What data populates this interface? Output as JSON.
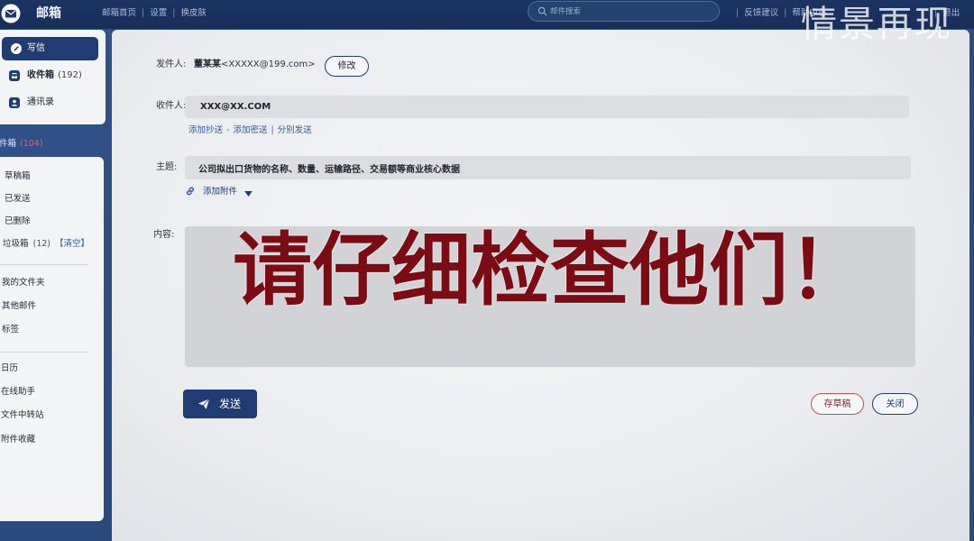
{
  "theme": {
    "header_bg": "#1b3462",
    "primary": "#1f3d73",
    "link": "#2f5a9a",
    "caption": "#7c0c14",
    "danger": "#c0504d",
    "count_alert": "#e0656a"
  },
  "icons": {
    "logo": "envelope-icon",
    "search": "search-icon",
    "compose": "pen-icon",
    "inbox": "inbox-icon",
    "contacts": "contacts-icon",
    "attach": "link-icon",
    "attach_menu": "chevron-down-icon",
    "send": "paper-plane-icon"
  },
  "header": {
    "logo_text": "邮箱",
    "nav": [
      "邮箱首页",
      "设置",
      "换皮肤"
    ],
    "separator": "|",
    "search_placeholder": "邮件搜索",
    "right_links": [
      "反馈建议",
      "帮助中心",
      "退出"
    ],
    "watermark": "情景再现"
  },
  "sidebar": {
    "compose_label": "写信",
    "inbox": {
      "label": "收件箱",
      "count": "(192)"
    },
    "contacts_label": "通讯录",
    "folder_strip": {
      "label": "件箱",
      "count": "(104)"
    },
    "system_folders": [
      "草稿箱",
      "已发送",
      "已删除"
    ],
    "junk": {
      "label": "垃圾箱",
      "count": "(12)",
      "action": "【清空】"
    },
    "personal_folders": [
      "我的文件夹",
      "其他邮件",
      "标签"
    ],
    "tools": [
      "日历",
      "在线助手",
      "文件中转站",
      "附件收藏"
    ]
  },
  "form": {
    "sender_label": "发件人:",
    "sender_name": "董某某",
    "sender_email": "<XXXXX@199.com>",
    "modify_label": "修改",
    "recipient_label": "收件人:",
    "recipient": "XXX@XX.COM",
    "cc_links": [
      "添加抄送",
      "添加密送",
      "分别发送"
    ],
    "cc_separators": [
      "-",
      "|"
    ],
    "subject_label": "主题:",
    "subject": "公司拟出口货物的名称、数量、运输路径、交易额等商业核心数据",
    "attach_label": "添加附件",
    "content_label": "内容:",
    "overlay_caption": "请仔细检查他们！"
  },
  "actions": {
    "send_label": "发送",
    "draft_label": "存草稿",
    "close_label": "关闭"
  }
}
